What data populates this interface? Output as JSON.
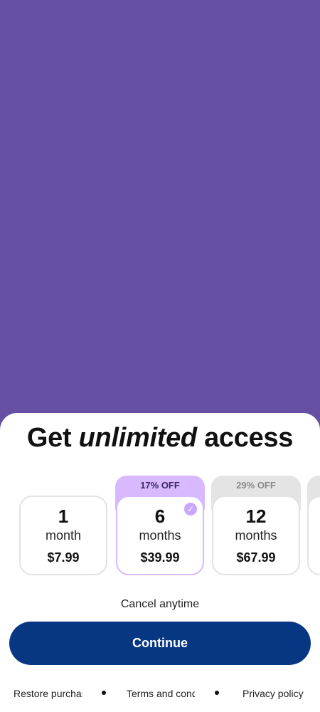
{
  "headline": {
    "before": "Get ",
    "emphasis": "unlimited",
    "after": " access"
  },
  "plans": [
    {
      "number": "1",
      "unit": "month",
      "price": "$7.99",
      "badge": "",
      "selected": false
    },
    {
      "number": "6",
      "unit": "months",
      "price": "$39.99",
      "badge": "17% OFF",
      "selected": true
    },
    {
      "number": "12",
      "unit": "months",
      "price": "$67.99",
      "badge": "29% OFF",
      "selected": false
    }
  ],
  "cancel_text": "Cancel anytime",
  "continue_label": "Continue",
  "footer": {
    "restore": "Restore purchases",
    "terms": "Terms and conditions",
    "privacy": "Privacy policy"
  },
  "colors": {
    "hero_background": "#6650a4",
    "primary_button": "#073782",
    "selected_accent": "#d8b9ff"
  },
  "icons": {
    "selected_indicator": "check-circle-icon"
  }
}
